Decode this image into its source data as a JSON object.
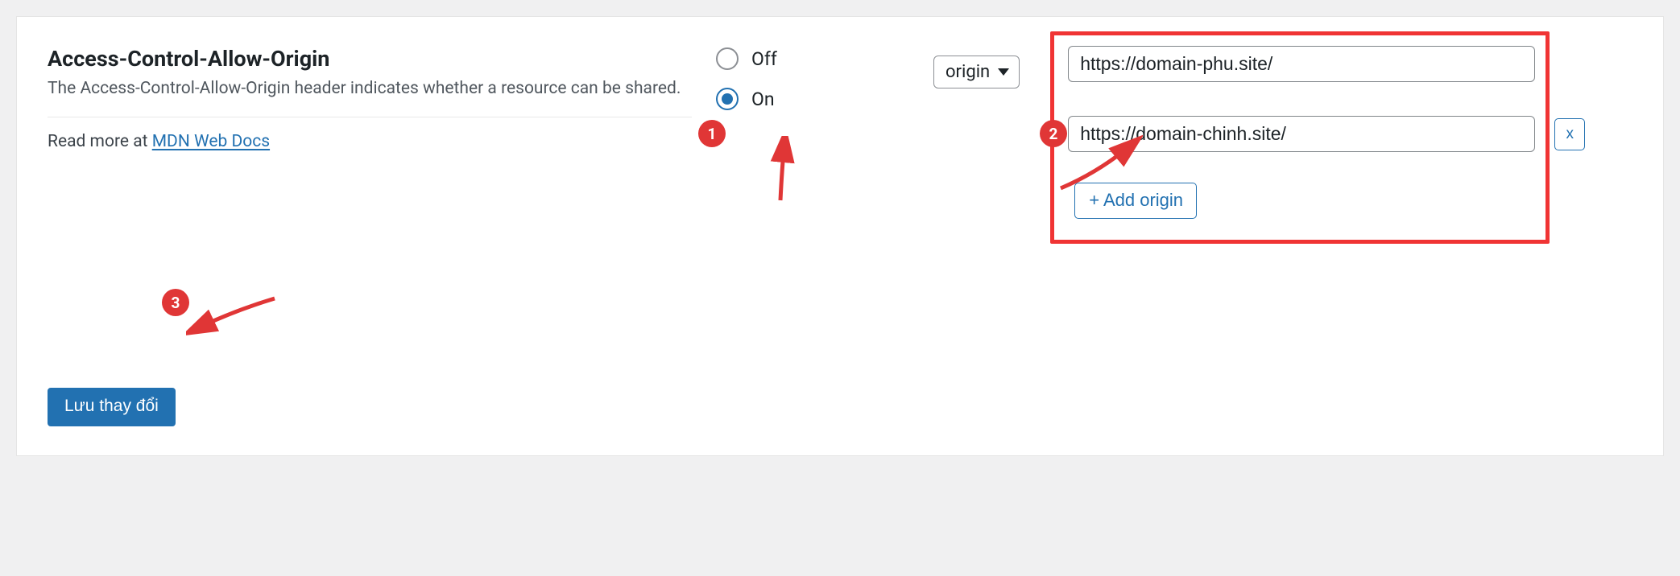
{
  "setting": {
    "title": "Access-Control-Allow-Origin",
    "description": "The Access-Control-Allow-Origin header indicates whether a resource can be shared.",
    "read_more_prefix": "Read more at ",
    "mdn_link_text": "MDN Web Docs"
  },
  "radio": {
    "off_label": "Off",
    "on_label": "On",
    "value": "on"
  },
  "origin_select": {
    "selected": "origin"
  },
  "origins": [
    {
      "value": "https://domain-phu.site/"
    },
    {
      "value": "https://domain-chinh.site/"
    }
  ],
  "buttons": {
    "remove": "x",
    "add_origin": "+ Add origin",
    "save": "Lưu thay đổi"
  },
  "annotations": {
    "badge1": "1",
    "badge2": "2",
    "badge3": "3"
  }
}
